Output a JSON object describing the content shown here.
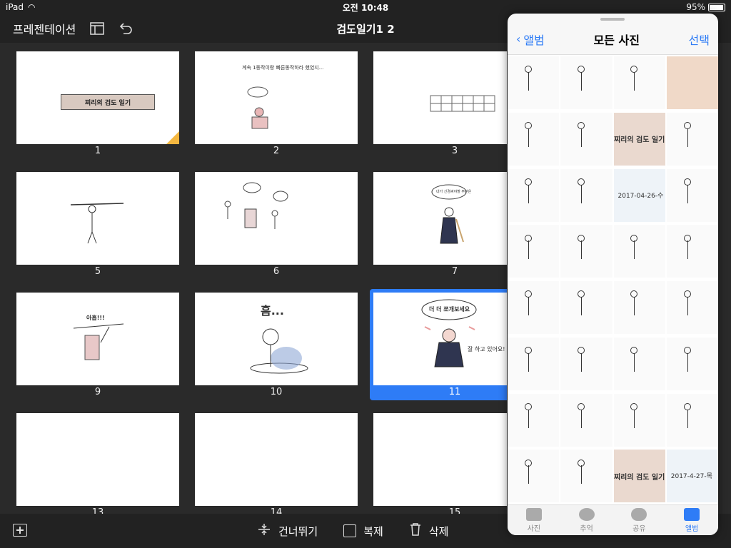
{
  "status": {
    "device": "iPad",
    "time": "오전 10:48",
    "battery": "95%"
  },
  "toolbar": {
    "presentation": "프레젠테이션",
    "doc_title": "검도일기1 2"
  },
  "slides": [
    {
      "num": "1",
      "banner": "찌리의 검도 일기"
    },
    {
      "num": "2",
      "text": "계속 1동작이랑 빠른동작하라 했었지..."
    },
    {
      "num": "3"
    },
    {
      "num": "5"
    },
    {
      "num": "6"
    },
    {
      "num": "7",
      "bubble": "내가 신경써야할 부분은"
    },
    {
      "num": "9",
      "text": "아홉!!!"
    },
    {
      "num": "10",
      "text": "흠..."
    },
    {
      "num": "11",
      "bubble": "더 더 쪼개보세요",
      "side": "잘 하고 있어요!"
    },
    {
      "num": "13"
    },
    {
      "num": "14"
    },
    {
      "num": "15"
    }
  ],
  "bottombar": {
    "skip": "건너뛰기",
    "duplicate": "복제",
    "delete": "삭제"
  },
  "photos_panel": {
    "back": "앨범",
    "title": "모든 사진",
    "select": "선택",
    "label1": "찌리의 검도 일기",
    "date1": "2017-04-26-수",
    "label2": "찌리의 검도 일기",
    "date2": "2017-4-27-목",
    "tabs": [
      "사진",
      "추억",
      "공유",
      "앨범"
    ]
  }
}
